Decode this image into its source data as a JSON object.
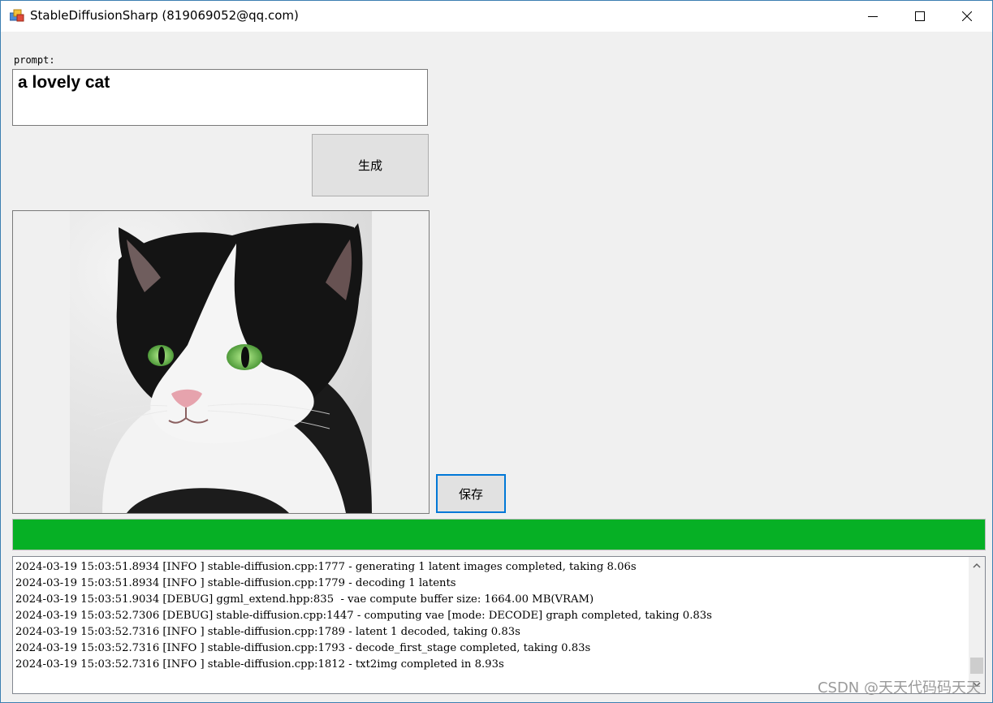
{
  "window": {
    "title": "StableDiffusionSharp (819069052@qq.com)",
    "controls": {
      "minimize": "minimize-icon",
      "maximize": "maximize-icon",
      "close": "close-icon"
    }
  },
  "prompt": {
    "label": "prompt:",
    "value": "a lovely cat"
  },
  "buttons": {
    "generate": "生成",
    "save": "保存"
  },
  "image": {
    "subject": "generated black-and-white cat portrait"
  },
  "progress": {
    "value": 1.0,
    "color": "#06b025"
  },
  "log": {
    "lines": [
      "2024-03-19 15:03:51.8934 [INFO ] stable-diffusion.cpp:1777 - generating 1 latent images completed, taking 8.06s",
      "2024-03-19 15:03:51.8934 [INFO ] stable-diffusion.cpp:1779 - decoding 1 latents",
      "2024-03-19 15:03:51.9034 [DEBUG] ggml_extend.hpp:835  - vae compute buffer size: 1664.00 MB(VRAM)",
      "2024-03-19 15:03:52.7306 [DEBUG] stable-diffusion.cpp:1447 - computing vae [mode: DECODE] graph completed, taking 0.83s",
      "2024-03-19 15:03:52.7316 [INFO ] stable-diffusion.cpp:1789 - latent 1 decoded, taking 0.83s",
      "2024-03-19 15:03:52.7316 [INFO ] stable-diffusion.cpp:1793 - decode_first_stage completed, taking 0.83s",
      "2024-03-19 15:03:52.7316 [INFO ] stable-diffusion.cpp:1812 - txt2img completed in 8.93s"
    ]
  },
  "watermark": "CSDN @天天代码码天天"
}
